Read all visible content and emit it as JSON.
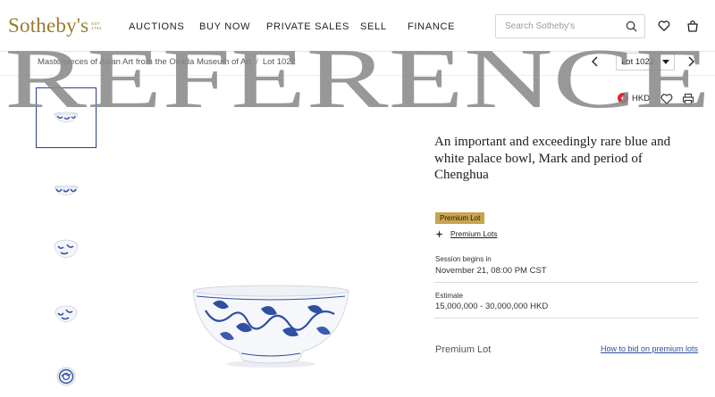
{
  "header": {
    "logo_text": "Sotheby's",
    "logo_est": [
      "EST",
      "1744"
    ],
    "nav": [
      {
        "label": "AUCTIONS"
      },
      {
        "label": "BUY NOW"
      },
      {
        "label": "PRIVATE SALES"
      },
      {
        "label": "SELL"
      },
      {
        "label": "FINANCE"
      }
    ],
    "search_placeholder": "Search Sotheby's",
    "icons": [
      "search-icon",
      "heart-icon",
      "bag-icon"
    ]
  },
  "breadcrumb": {
    "parent": "Masterpieces of Asian Art from the Okada Museum of Art",
    "separator": "/",
    "current": "Lot 1022"
  },
  "lot_nav": {
    "selected": "Lot 1022",
    "icons": [
      "chevron-left-icon",
      "chevron-down-icon",
      "chevron-right-icon"
    ]
  },
  "currency": {
    "label": "HKD",
    "flag": "hong-kong-flag-icon"
  },
  "actions": [
    "heart-icon",
    "print-icon"
  ],
  "thumbnails": [
    {
      "view": "bowl-side",
      "active": true
    },
    {
      "view": "bowl-side",
      "active": false
    },
    {
      "view": "bowl-interior",
      "active": false
    },
    {
      "view": "bowl-interior",
      "active": false
    },
    {
      "view": "bowl-base",
      "active": false
    }
  ],
  "lot": {
    "title": "An important and exceedingly rare blue and white palace bowl, Mark and period of Chenghua",
    "badge": "Premium Lot",
    "premium_link": "Premium Lots",
    "session_label": "Session begins in",
    "session_value": "November 21, 08:00 PM CST",
    "estimate_label": "Estimate",
    "estimate_value": "15,000,000 - 30,000,000 HKD",
    "premium_text": "Premium Lot",
    "how_to_bid": "How to bid on premium lots"
  },
  "watermark": "REFERENCE",
  "colors": {
    "brand_gold": "#9b7a2e",
    "badge_gold": "#c9a44e",
    "link_blue": "#2b4fa0",
    "active_thumb_border": "#2b3f8f",
    "porcelain_blue": "#2f4fa3",
    "watermark_gray": "#8a8a8a"
  }
}
